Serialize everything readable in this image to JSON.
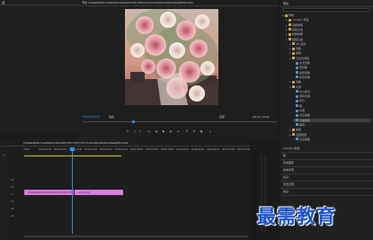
{
  "source_monitor": {
    "title": "源：",
    "zoom": "1/4"
  },
  "program_monitor": {
    "title": "节目  2da4ab8fdb7ee0492014a43e57d0fc7bf7c3d17167b05a1b5f2da4ab8fdb7ee0",
    "timecode_left": "00;00;04;00",
    "fit": "适合",
    "quality": "完整",
    "timecode_right": "00;01;13;16"
  },
  "project_panel": {
    "title": "项目",
    "tree": [
      {
        "label": "特效",
        "indent": 0,
        "type": "folder"
      },
      {
        "label": "Lumetri 预设",
        "indent": 1,
        "type": "folder"
      },
      {
        "label": "音频效果",
        "indent": 1,
        "type": "folder"
      },
      {
        "label": "音频过渡",
        "indent": 1,
        "type": "folder"
      },
      {
        "label": "视频效果",
        "indent": 1,
        "type": "folder"
      },
      {
        "label": "视频过渡",
        "indent": 1,
        "type": "folder"
      },
      {
        "label": "3D 运动",
        "indent": 2,
        "type": "folder"
      },
      {
        "label": "划像",
        "indent": 2,
        "type": "folder"
      },
      {
        "label": "擦除",
        "indent": 2,
        "type": "folder"
      },
      {
        "label": "沉浸式视频",
        "indent": 2,
        "type": "folder"
      },
      {
        "label": "交叉划像",
        "indent": 3,
        "type": "file"
      },
      {
        "label": "圆划像",
        "indent": 3,
        "type": "file"
      },
      {
        "label": "盒形划像",
        "indent": 3,
        "type": "file"
      },
      {
        "label": "菱形划像",
        "indent": 3,
        "type": "file"
      },
      {
        "label": "溶解",
        "indent": 2,
        "type": "folder"
      },
      {
        "label": "内滑",
        "indent": 2,
        "type": "folder"
      },
      {
        "label": "中心拆分",
        "indent": 3,
        "type": "file"
      },
      {
        "label": "带状内滑",
        "indent": 3,
        "type": "file"
      },
      {
        "label": "拆分",
        "indent": 3,
        "type": "file"
      },
      {
        "label": "推",
        "indent": 3,
        "type": "file"
      },
      {
        "label": "内滑",
        "indent": 3,
        "type": "file"
      },
      {
        "label": "交叉缩放",
        "indent": 3,
        "type": "file"
      },
      {
        "label": "页面剥落",
        "indent": 3,
        "type": "file",
        "selected": true
      },
      {
        "label": "翻页",
        "indent": 3,
        "type": "file"
      },
      {
        "label": "缩放",
        "indent": 2,
        "type": "folder"
      },
      {
        "label": "页面剥落",
        "indent": 2,
        "type": "folder"
      },
      {
        "label": "交叉缩放",
        "indent": 3,
        "type": "file"
      }
    ],
    "sections": [
      "Lumetri 颜色",
      "库",
      "基本图形",
      "基本声音",
      "标记",
      "历史记录",
      "信息"
    ]
  },
  "timeline": {
    "title": "2da4ab8fdb7ee0492014a43e57d0fc7bf7c3d17167b05a1b5f2da4ab8fdb7ee0",
    "ruler": [
      "00;00",
      "00;00;04;00",
      "00;00;08;00",
      "00;00;12;00",
      "00;00;16;00",
      "00;00;20;00",
      "00;00;24;00",
      "00;00;28;00",
      "00;00;32;00",
      "00;00;36;00",
      "00;00;40;00",
      "00;00;44;00",
      "00;00;48;00",
      "00;00;52;00",
      "00;00;56;00"
    ],
    "clips": [
      "2da4ab8fdb7ee0492014a43e57d0fc7bf7c3d",
      "aa.mp4 [V]"
    ],
    "tracks": [
      "V3",
      "V2",
      "V1",
      "A1",
      "A2",
      "A3"
    ]
  },
  "watermark": "最需教育",
  "colors": {
    "accent": "#2d8ceb",
    "clip": "#d87fdb",
    "playhead": "#2d8ceb",
    "yellow": "#d9c844",
    "bg": "#1b1b1b",
    "panel": "#232323"
  }
}
